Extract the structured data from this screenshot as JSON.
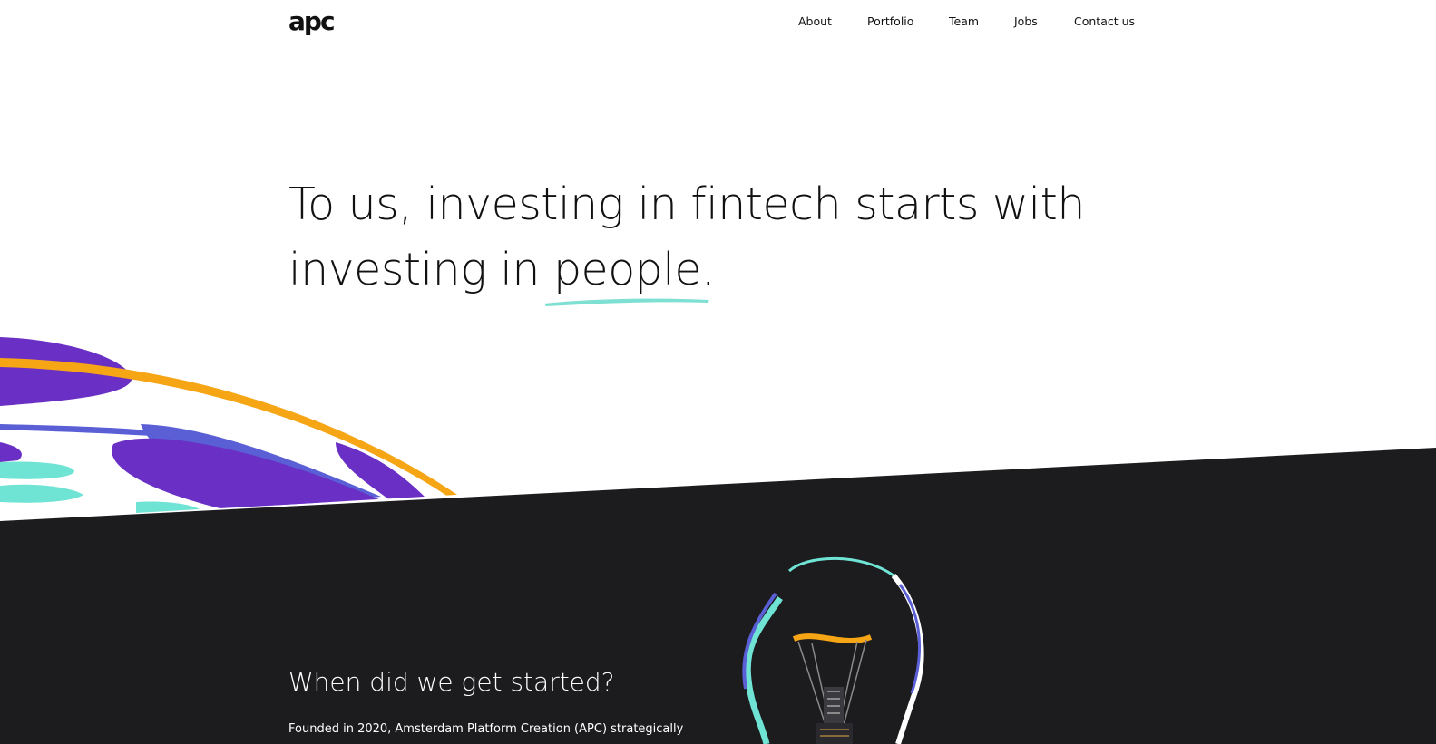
{
  "header": {
    "logo_text": "apc",
    "nav": [
      {
        "label": "About"
      },
      {
        "label": "Portfolio"
      },
      {
        "label": "Team"
      },
      {
        "label": "Jobs"
      },
      {
        "label": "Contact us"
      }
    ]
  },
  "hero": {
    "line1": "To us, investing in fintech starts with",
    "line2_prefix": "investing in ",
    "highlight_word": "people",
    "line2_suffix": "."
  },
  "section": {
    "title": "When did we get started?",
    "text": "Founded in 2020, Amsterdam Platform Creation (APC) strategically"
  },
  "colors": {
    "dark_bg": "#1c1b1e",
    "purple": "#6a2fc4",
    "blue": "#5a5fd6",
    "teal": "#6fe3d4",
    "orange": "#f6a515",
    "underline_teal": "#7ee0d2"
  },
  "icons": [
    "logo",
    "brush-underline",
    "paint-stroke-illustration",
    "lightbulb-image"
  ]
}
